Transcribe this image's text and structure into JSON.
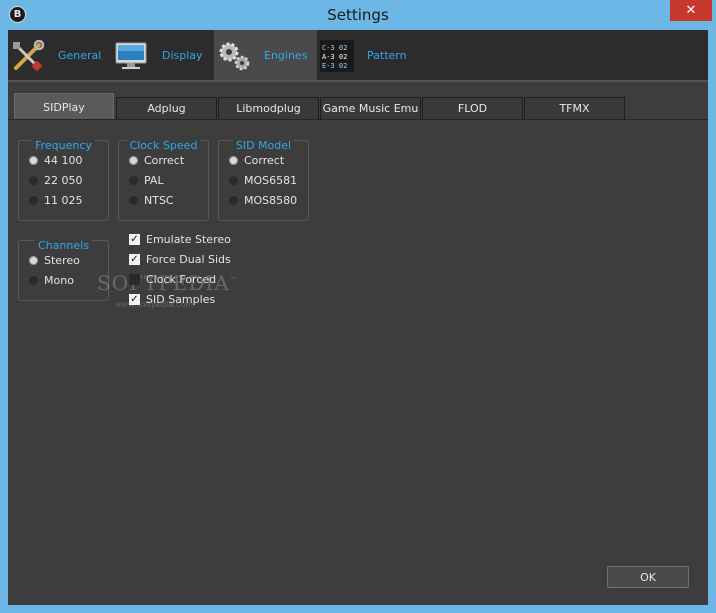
{
  "window": {
    "title": "Settings",
    "close_glyph": "✕",
    "app_icon_glyph": "B"
  },
  "nav": [
    {
      "label": "General",
      "icon": "tools-icon"
    },
    {
      "label": "Display",
      "icon": "monitor-icon"
    },
    {
      "label": "Engines",
      "icon": "gears-icon",
      "active": true
    },
    {
      "label": "Pattern",
      "icon": "pattern-icon"
    }
  ],
  "pattern_icon_text": [
    "C-3 02",
    "A-3 02",
    "E-3 02"
  ],
  "tabs": [
    "SIDPlay",
    "Adplug",
    "Libmodplug",
    "Game Music Emu",
    "FLOD",
    "TFMX"
  ],
  "active_tab": "SIDPlay",
  "frequency": {
    "title": "Frequency",
    "options": [
      "44 100",
      "22 050",
      "11 025"
    ],
    "selected": "44 100"
  },
  "clock_speed": {
    "title": "Clock Speed",
    "options": [
      "Correct",
      "PAL",
      "NTSC"
    ],
    "selected": "Correct"
  },
  "sid_model": {
    "title": "SID Model",
    "options": [
      "Correct",
      "MOS6581",
      "MOS8580"
    ],
    "selected": "Correct"
  },
  "channels": {
    "title": "Channels",
    "options": [
      "Stereo",
      "Mono"
    ],
    "selected": "Stereo"
  },
  "checkboxes": [
    {
      "label": "Emulate Stereo",
      "checked": true
    },
    {
      "label": "Force Dual Sids",
      "checked": true
    },
    {
      "label": "Clock Forced",
      "checked": false
    },
    {
      "label": "SID Samples",
      "checked": true
    }
  ],
  "watermark": {
    "text": "SOFTPEDIA",
    "url": "www.softpedia.com",
    "mark": "™"
  },
  "ok_label": "OK",
  "colors": {
    "accent": "#2fa8e8",
    "panel": "#3d3d3d",
    "titlebar": "#6db7e6",
    "close": "#c6372c"
  }
}
